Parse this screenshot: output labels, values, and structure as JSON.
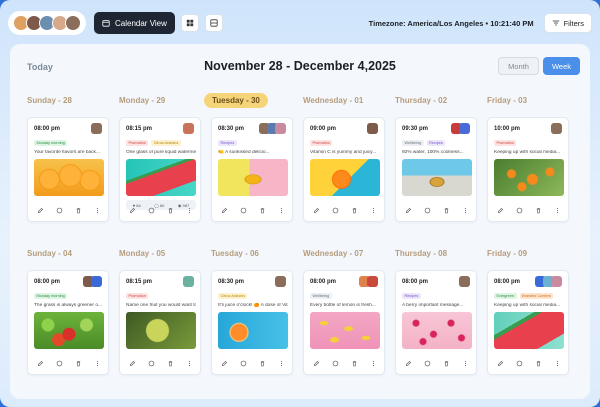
{
  "toolbar": {
    "calendar_view_label": "Calendar View",
    "timezone": "Timezone: America/Los Angeles • 10:21:40 PM",
    "filters_label": "Filters",
    "avatar_colors": [
      "#e0a060",
      "#7d5a4a",
      "#6c8fb0",
      "#d7a98a",
      "#8a6d5a"
    ]
  },
  "header": {
    "today_label": "Today",
    "date_range": "November 28 - December 4,2025",
    "view_month": "Month",
    "view_week": "Week"
  },
  "days_row1": [
    "Sunday - 28",
    "Monday - 29",
    "Tuesday - 30",
    "Wednesday - 01",
    "Thursday - 02",
    "Friday - 03"
  ],
  "days_row2": [
    "Sunday - 04",
    "Monday - 05",
    "Tuesday - 06",
    "Wednesday - 07",
    "Thursday - 08",
    "Friday - 09"
  ],
  "cards_row1": [
    {
      "time": "08:00 pm",
      "tags": [
        {
          "t": "Monday morning",
          "c": "green"
        }
      ],
      "caption": "Your favorite flavors are back...",
      "image": "orange-slices",
      "has_stats": false
    },
    {
      "time": "08:15 pm",
      "tags": [
        {
          "t": "Promotion",
          "c": "red"
        },
        {
          "t": "Citrus Araloins",
          "c": "yellow"
        }
      ],
      "caption": "One glass of pure liquid watermelon...",
      "image": "watermelon-slice",
      "has_stats": true,
      "stats": [
        "84",
        "60",
        "987"
      ]
    },
    {
      "time": "08:30 pm",
      "tags": [
        {
          "t": "Recipes",
          "c": "purple"
        }
      ],
      "caption": "🍋 A sunkissed delicio...",
      "image": "lemon-pastel",
      "has_stats": false
    },
    {
      "time": "09:00 pm",
      "tags": [
        {
          "t": "Promotion",
          "c": "red"
        }
      ],
      "caption": "Vitamin C is yummy and juicy...",
      "image": "orange-yellow",
      "has_stats": false
    },
    {
      "time": "09:30 pm",
      "tags": [
        {
          "t": "Wellbeing",
          "c": "gray"
        },
        {
          "t": "Recipes",
          "c": "purple"
        }
      ],
      "caption": "92% water, 100% coolness...",
      "image": "pineapple-beach",
      "has_stats": false
    },
    {
      "time": "10:00 pm",
      "tags": [
        {
          "t": "Promotion",
          "c": "red"
        }
      ],
      "caption": "Keeping up with social media...",
      "image": "orange-tree",
      "has_stats": false
    }
  ],
  "cards_row2": [
    {
      "time": "08:00 pm",
      "tags": [
        {
          "t": "Monday morning",
          "c": "green"
        }
      ],
      "caption": "The grass is always greener o...",
      "image": "green-apples",
      "has_stats": false
    },
    {
      "time": "08:15 pm",
      "tags": [
        {
          "t": "Promotion",
          "c": "red"
        }
      ],
      "caption": "Name one fruit you would want to...",
      "image": "grapes",
      "has_stats": false
    },
    {
      "time": "08:30 pm",
      "tags": [
        {
          "t": "Citrus Araloins",
          "c": "yellow"
        }
      ],
      "caption": "It's juice o'clock! 🍊 A dose of Vitamin C...",
      "image": "orange-blue",
      "has_stats": false
    },
    {
      "time": "08:00 pm",
      "tags": [
        {
          "t": "Wellbeing",
          "c": "gray"
        }
      ],
      "caption": "Every bottle of lemon is fresh...",
      "image": "lemon-pink",
      "has_stats": false
    },
    {
      "time": "08:00 pm",
      "tags": [
        {
          "t": "Recipes",
          "c": "purple"
        }
      ],
      "caption": "A berry important message...",
      "image": "raspberries",
      "has_stats": false
    },
    {
      "time": "08:00 pm",
      "tags": [
        {
          "t": "Evergreen",
          "c": "green"
        },
        {
          "t": "Branded Content",
          "c": "orange"
        }
      ],
      "caption": "Keeping up with social media...",
      "image": "watermelon-mint",
      "has_stats": false
    }
  ]
}
